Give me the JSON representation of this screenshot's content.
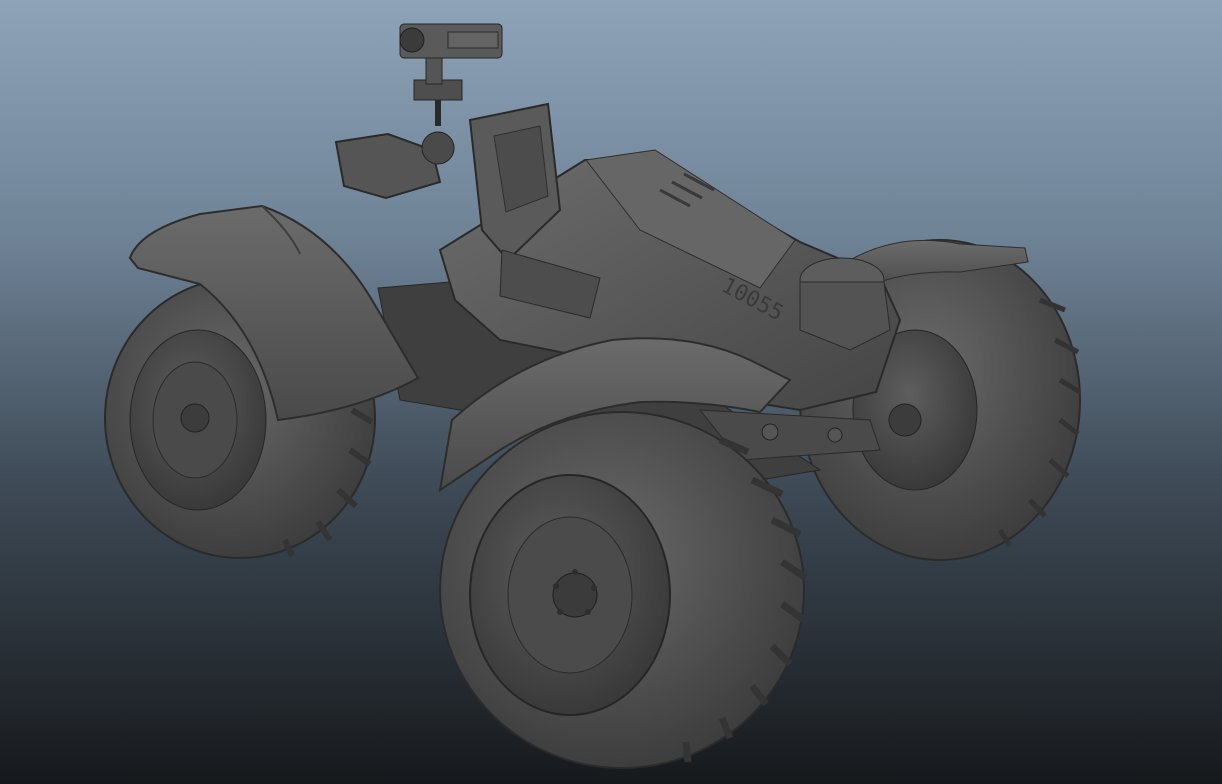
{
  "viewport": {
    "background_top": "#8ea3b8",
    "background_bottom": "#16191c",
    "shading": "smooth-shaded-grey"
  },
  "model": {
    "subject": "quad-bike-atv",
    "body_color": "#585858",
    "decal_text": "10055"
  }
}
